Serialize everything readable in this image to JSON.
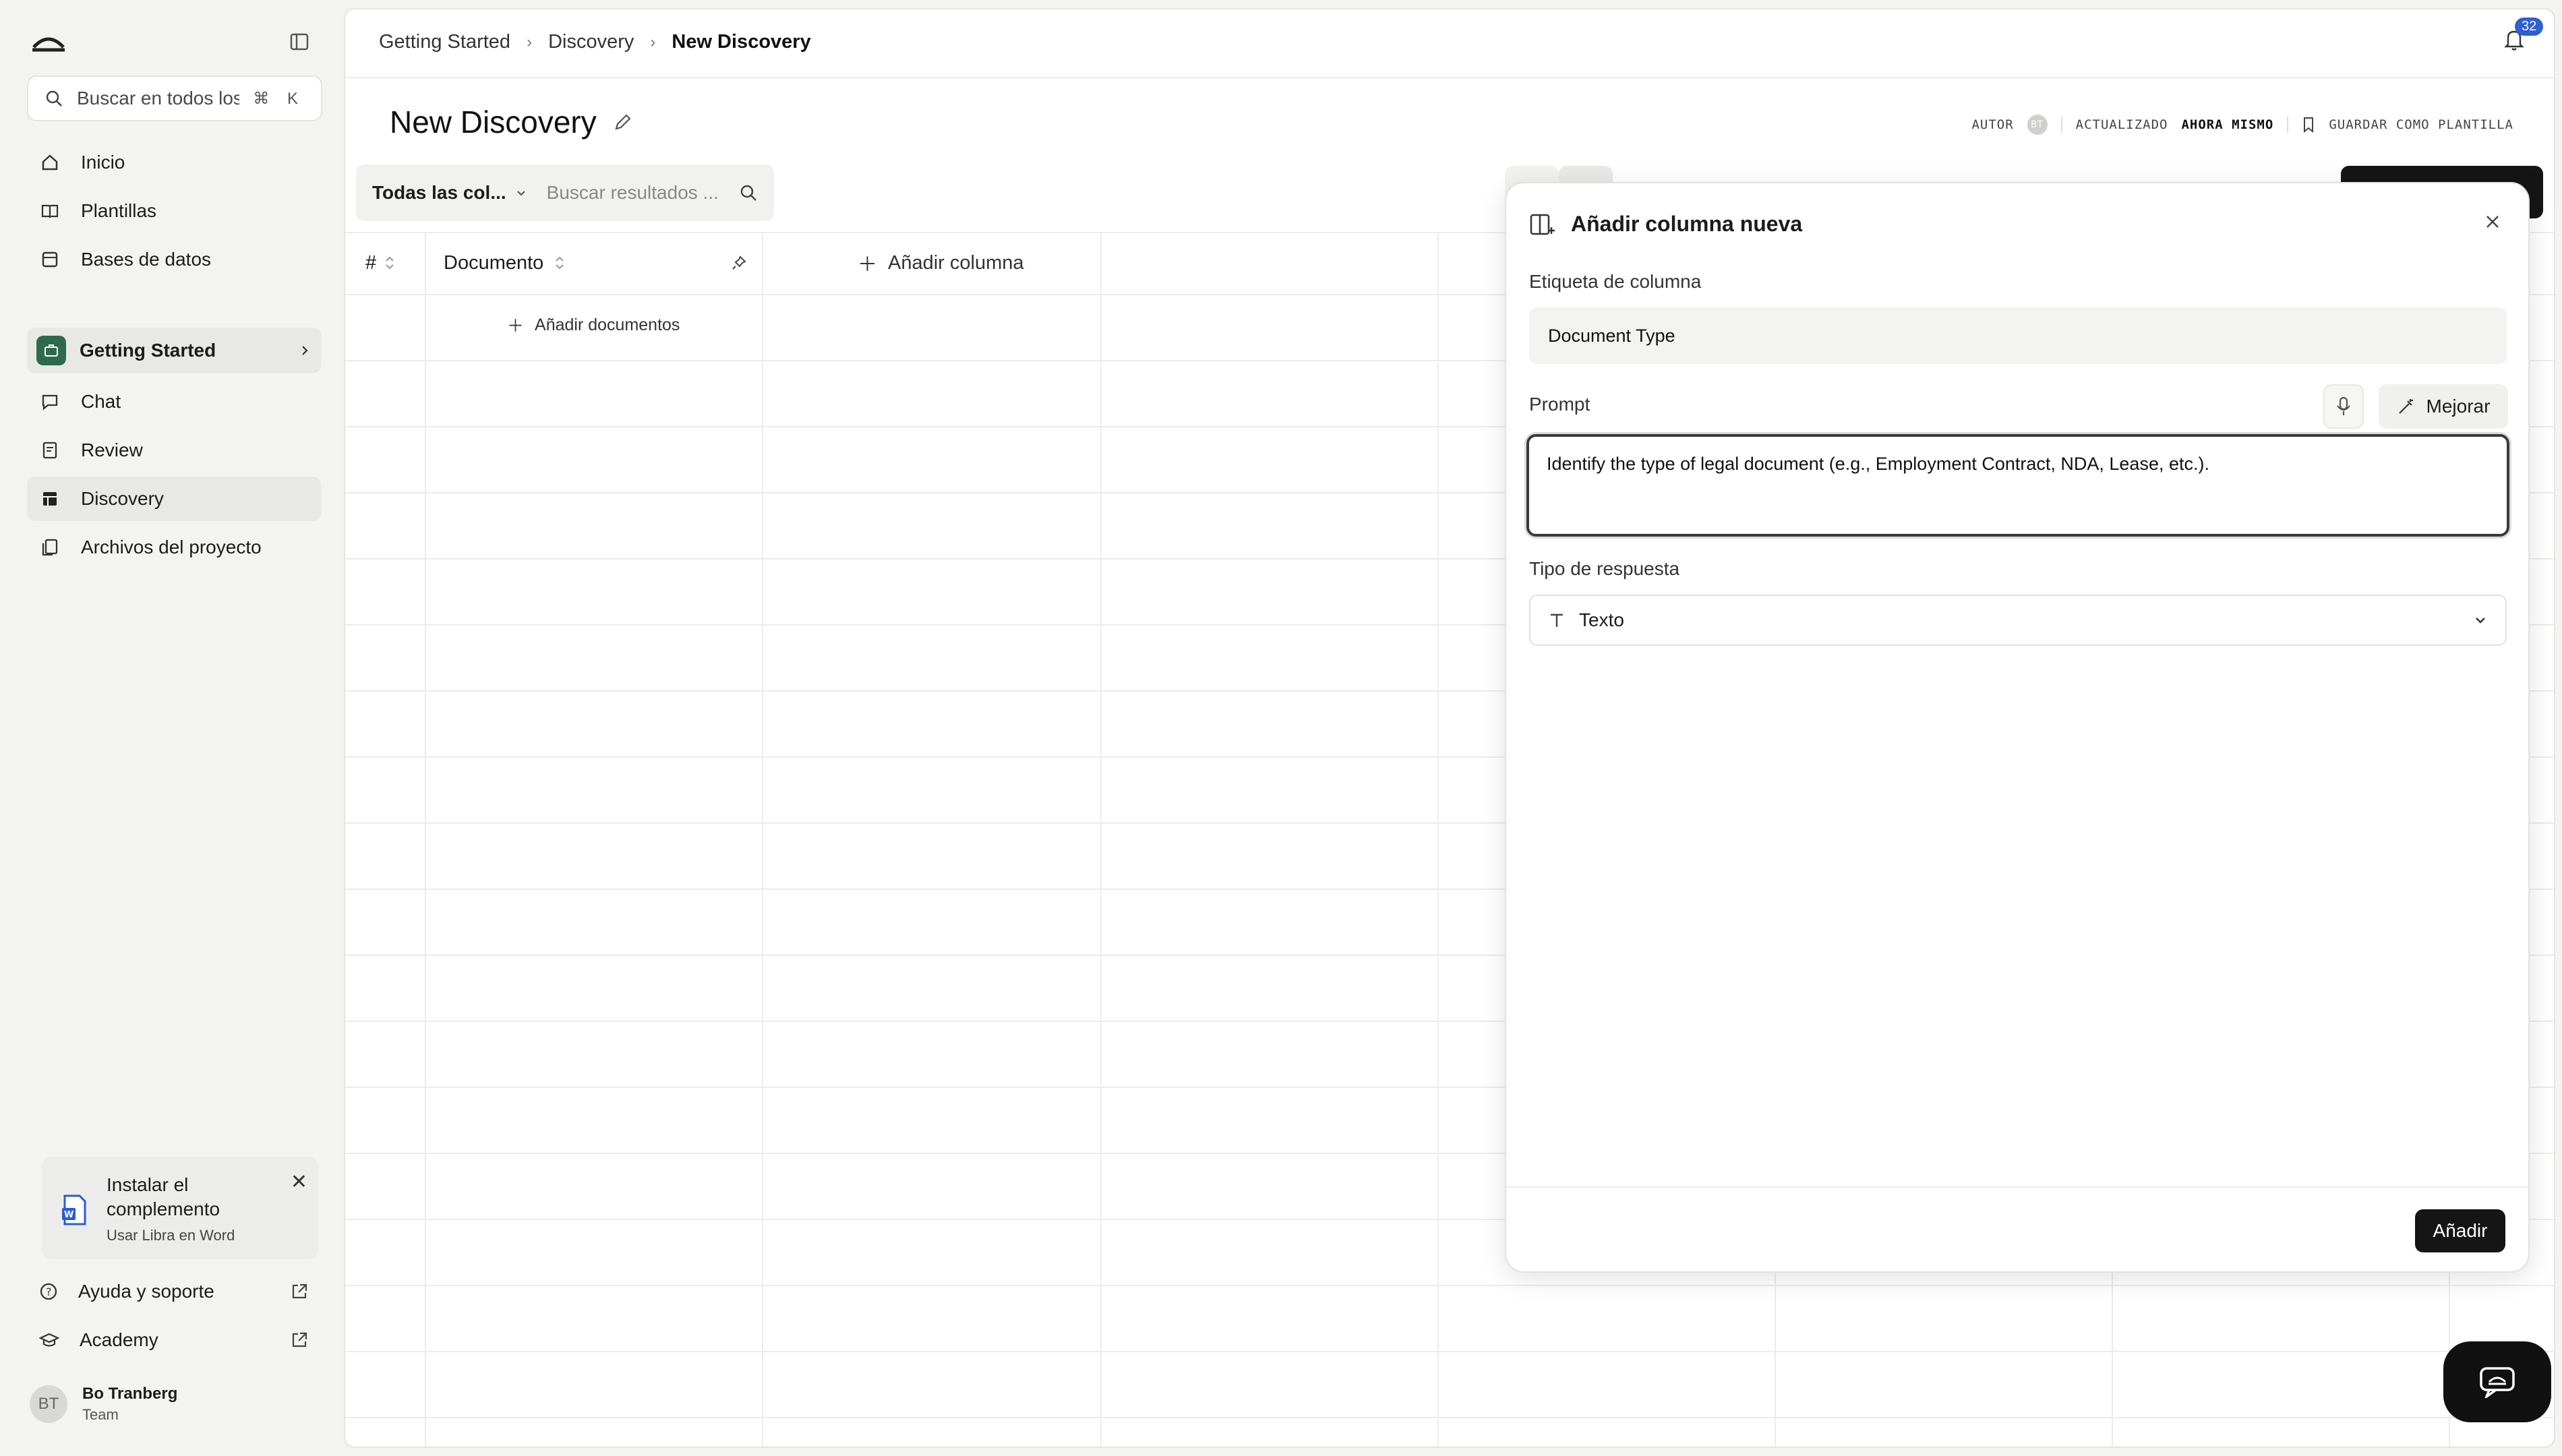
{
  "sidebar": {
    "search_placeholder": "Buscar en todos los ...",
    "search_shortcut": "⌘ K",
    "nav": [
      {
        "label": "Inicio",
        "icon": "home-icon"
      },
      {
        "label": "Plantillas",
        "icon": "book-icon"
      },
      {
        "label": "Bases de datos",
        "icon": "database-icon"
      }
    ],
    "project": {
      "label": "Getting Started",
      "icon": "briefcase-icon"
    },
    "project_nav": [
      {
        "label": "Chat",
        "icon": "chat-icon"
      },
      {
        "label": "Review",
        "icon": "review-icon"
      },
      {
        "label": "Discovery",
        "icon": "table-icon",
        "active": true
      },
      {
        "label": "Archivos del proyecto",
        "icon": "files-icon"
      }
    ],
    "plugin_card": {
      "title": "Instalar el complemento",
      "subtitle": "Usar Libra en Word",
      "icon": "word-icon"
    },
    "footer": [
      {
        "label": "Ayuda y soporte",
        "icon": "help-icon"
      },
      {
        "label": "Academy",
        "icon": "academy-icon"
      }
    ],
    "user": {
      "initials": "BT",
      "name": "Bo Tranberg",
      "team": "Team"
    }
  },
  "header": {
    "breadcrumb": [
      "Getting Started",
      "Discovery",
      "New Discovery"
    ],
    "notifications_count": "32"
  },
  "page": {
    "title": "New Discovery",
    "meta": {
      "author_label": "AUTOR",
      "author_initials": "BT",
      "updated_label": "ACTUALIZADO",
      "updated_value": "AHORA MISMO",
      "save_template": "GUARDAR COMO PLANTILLA"
    }
  },
  "filter": {
    "column_select": "Todas las col...",
    "search_placeholder": "Buscar resultados ..."
  },
  "table": {
    "col_index": "#",
    "col_document": "Documento",
    "add_column": "Añadir columna",
    "add_documents": "Añadir documentos"
  },
  "modal": {
    "title": "Añadir columna nueva",
    "column_label_label": "Etiqueta de columna",
    "column_label_value": "Document Type",
    "prompt_label": "Prompt",
    "improve_label": "Mejorar",
    "prompt_value": "Identify the type of legal document (e.g., Employment Contract, NDA, Lease, etc.).",
    "response_type_label": "Tipo de respuesta",
    "response_type_value": "Texto",
    "submit_label": "Añadir"
  },
  "colors": {
    "accent": "#2e6b4e",
    "primary_button": "#151515",
    "notification_badge": "#2f5fd0"
  }
}
